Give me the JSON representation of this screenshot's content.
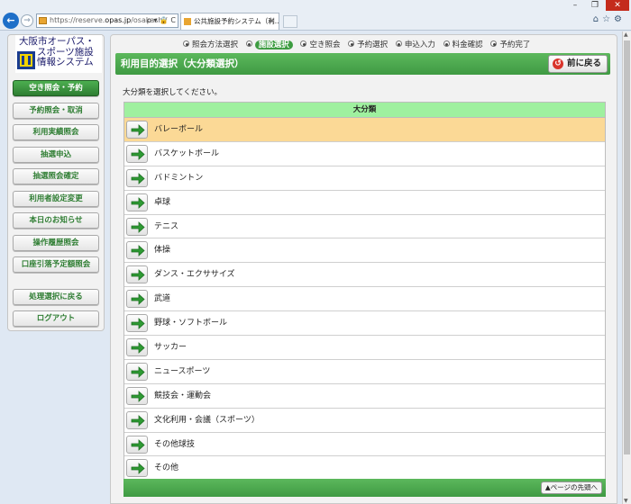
{
  "browser": {
    "address": {
      "prefix": "https://reserve.",
      "domain": "opas.jp",
      "path": "/osakashi/",
      "tools": "ρ ▾ 🔒 C"
    },
    "tab_title": "公共施設予約システム（利...",
    "toolbar_icons": [
      "home-icon",
      "star-icon",
      "gear-icon"
    ]
  },
  "logo": {
    "line1": "大阪市オーパス・",
    "line2": "スポーツ施設",
    "line3": "情報システム"
  },
  "sidebar": {
    "items": [
      {
        "label": "空き照会・予約",
        "active": true
      },
      {
        "label": "予約照会・取消"
      },
      {
        "label": "利用実績照会"
      },
      {
        "label": "抽選申込"
      },
      {
        "label": "抽選照会確定"
      },
      {
        "label": "利用者設定変更"
      },
      {
        "label": "本日のお知らせ"
      },
      {
        "label": "操作履歴照会"
      },
      {
        "label": "口座引落予定額照会"
      },
      {
        "label": "処理選択に戻る"
      },
      {
        "label": "ログアウト"
      }
    ]
  },
  "steps": [
    {
      "label": "照会方法選択"
    },
    {
      "label": "施設選択",
      "current": true
    },
    {
      "label": "空き照会"
    },
    {
      "label": "予約選択"
    },
    {
      "label": "申込入力"
    },
    {
      "label": "料金確認"
    },
    {
      "label": "予約完了"
    }
  ],
  "header": {
    "title": "利用目的選択（大分類選択）",
    "back_button": "前に戻る"
  },
  "instruction": "大分類を選択してください。",
  "table": {
    "header": "大分類",
    "rows": [
      {
        "label": "バレーボール",
        "selected": true
      },
      {
        "label": "バスケットボール"
      },
      {
        "label": "バドミントン"
      },
      {
        "label": "卓球"
      },
      {
        "label": "テニス"
      },
      {
        "label": "体操"
      },
      {
        "label": "ダンス・エクササイズ"
      },
      {
        "label": "武道"
      },
      {
        "label": "野球・ソフトボール"
      },
      {
        "label": "サッカー"
      },
      {
        "label": "ニュースポーツ"
      },
      {
        "label": "競技会・運動会"
      },
      {
        "label": "文化利用・会議（スポーツ）"
      },
      {
        "label": "その他球技"
      },
      {
        "label": "その他"
      }
    ]
  },
  "footer": {
    "top_button": "▲ページの先頭へ"
  },
  "colors": {
    "accent_green": "#3f9a43",
    "selected_row": "#fbd996",
    "table_header": "#9ff09f"
  }
}
